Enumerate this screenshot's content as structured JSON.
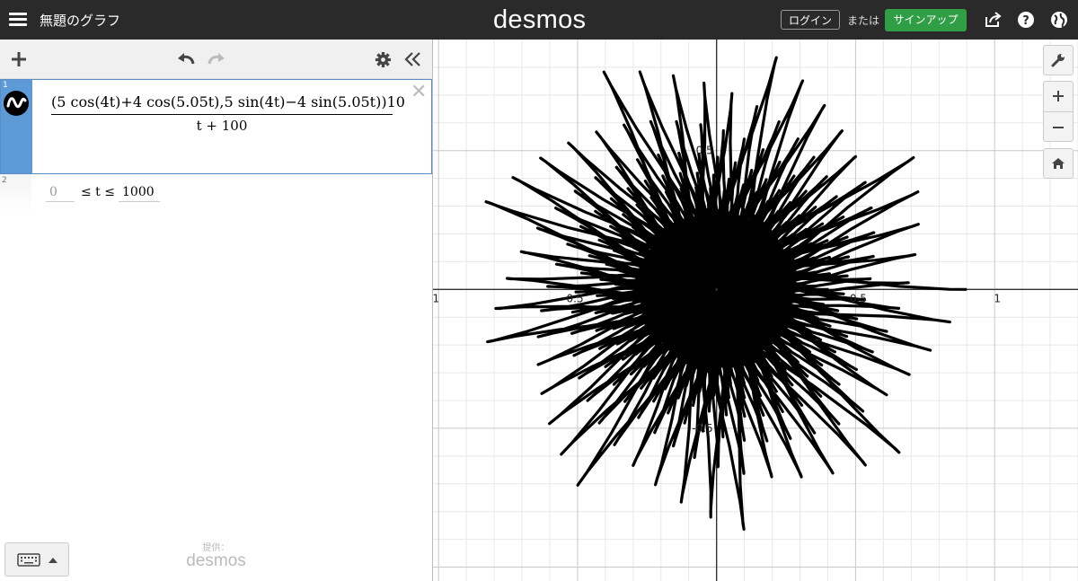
{
  "header": {
    "title": "無題のグラフ",
    "logo": "desmos",
    "login_label": "ログイン",
    "or_label": "または",
    "signup_label": "サインアップ",
    "signup_color": "#2f9e44",
    "icons": [
      "menu-icon",
      "share-icon",
      "help-icon",
      "globe-icon"
    ]
  },
  "toolbar": {
    "icons": [
      "plus-icon",
      "undo-icon",
      "redo-icon",
      "gear-icon",
      "collapse-icon"
    ]
  },
  "expressions": [
    {
      "index": "1",
      "icon": "parametric-curve-icon",
      "numerator": "(5 cos(4t)+4 cos(5.05t),5 sin(4t)−4 sin(5.05t))10",
      "denominator": "t + 100",
      "range_min": "0",
      "range_mid": "≤ t ≤",
      "range_max": "1000",
      "color": "#000000"
    },
    {
      "index": "2"
    }
  ],
  "keypad": {
    "icons": [
      "keyboard-icon",
      "caret-up-icon"
    ]
  },
  "powered_by": {
    "label": "提供：",
    "logo": "desmos"
  },
  "graph": {
    "x_range": [
      -1.02,
      1.3
    ],
    "y_range": [
      -1.05,
      0.9
    ],
    "x_tick_labels": [
      "-1",
      "-0.5",
      "0.5",
      "1"
    ],
    "y_tick_labels": [
      "0.5",
      "-0.5"
    ],
    "side_buttons": [
      "wrench-icon",
      "zoom-in-icon",
      "zoom-out-icon",
      "home-icon"
    ]
  }
}
